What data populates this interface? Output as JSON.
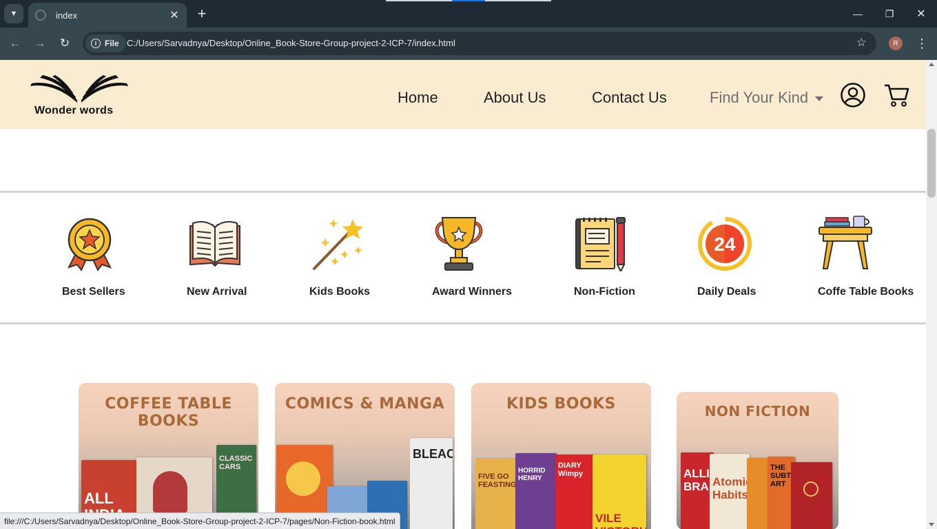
{
  "browser": {
    "tab_title": "index",
    "url_chip": "File",
    "url": "C:/Users/Sarvadnya/Desktop/Online_Book-Store-Group-project-2-ICP-7/index.html",
    "profile_initial": "R",
    "status_url": "file:///C:/Users/Sarvadnya/Desktop/Online_Book-Store-Group-project-2-ICP-7/pages/Non-Fiction-book.html"
  },
  "header": {
    "logo_text": "Wonder words",
    "nav": [
      "Home",
      "About Us",
      "Contact Us",
      "Find Your Kind"
    ],
    "bg_color": "#f9ecd0"
  },
  "categories": [
    {
      "label": "Best Sellers",
      "icon": "medal-icon"
    },
    {
      "label": "New Arrival",
      "icon": "open-book-icon"
    },
    {
      "label": "Kids Books",
      "icon": "magic-wand-icon"
    },
    {
      "label": "Award Winners",
      "icon": "trophy-icon"
    },
    {
      "label": "Non-Fiction",
      "icon": "notebook-pen-icon"
    },
    {
      "label": "Daily Deals",
      "icon": "24-hours-icon"
    },
    {
      "label": "Coffe Table Books",
      "icon": "coffee-table-icon"
    }
  ],
  "cards": [
    {
      "title": "COFFEE TABLE BOOKS"
    },
    {
      "title": "COMICS & MANGA"
    },
    {
      "title": "KIDS BOOKS"
    },
    {
      "title": "NON FICTION"
    }
  ]
}
